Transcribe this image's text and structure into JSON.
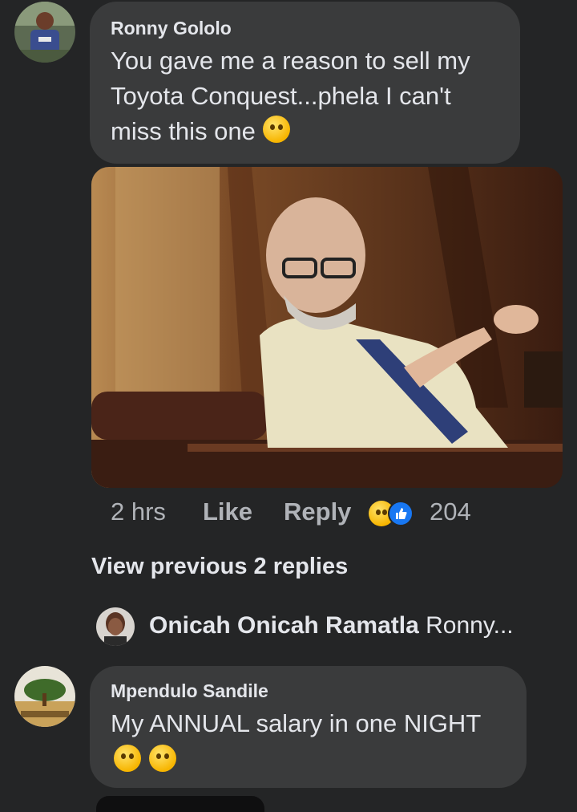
{
  "comment1": {
    "author": "Ronny Gololo",
    "text_line1": "You gave me a reason to sell my",
    "text_line2": "Toyota Conquest...phela I can't",
    "text_line3": "miss this one",
    "emoji": "crying-smile-emoji",
    "photo": "photo-man-gesturing",
    "time": "2 hrs",
    "like_label": "Like",
    "reply_label": "Reply",
    "reaction_count": "204",
    "reaction_icons": [
      "laugh-reaction-icon",
      "like-reaction-icon"
    ]
  },
  "replies": {
    "view_previous": "View previous 2 replies",
    "preview_author": "Onicah Onicah Ramatla",
    "preview_text": "Ronny..."
  },
  "comment2": {
    "author": "Mpendulo Sandile",
    "text": "My ANNUAL salary in one NIGHT",
    "emojis": [
      "crying-face-emoji",
      "weary-face-emoji"
    ]
  },
  "colors": {
    "background": "#242526",
    "bubble": "#3a3b3c",
    "text_primary": "#e4e6eb",
    "text_secondary": "#b0b3b8",
    "like_blue": "#1877f2",
    "reaction_yellow": "#f7b500"
  }
}
